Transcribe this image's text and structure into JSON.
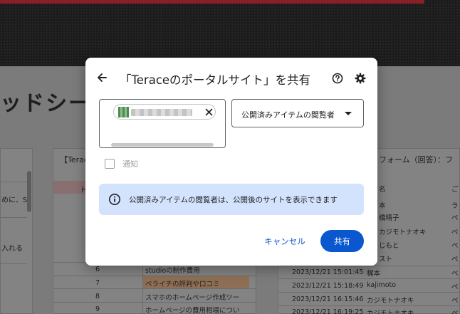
{
  "background": {
    "heading": "ッドシート",
    "left_panel_lines": [
      "めに、S",
      "入れる"
    ],
    "middle_panel": {
      "header": "【Terac",
      "tab_label": "ト",
      "rows": [
        {
          "num": "6",
          "text": "studioの制作費用"
        },
        {
          "num": "7",
          "text": "ペライチの評判や口コミ"
        },
        {
          "num": "8",
          "text": "スマホのホームページ作成ツー"
        },
        {
          "num": "9",
          "text": "ホームページの費用相場につい"
        }
      ]
    },
    "right_panel": {
      "header": "フォーム（回答）：フ",
      "col1": "名",
      "col2": "ご",
      "names": [
        "本",
        "橋晴子",
        "カジモトナオキ",
        "じもと",
        "スト"
      ],
      "side": [
        "ラ",
        "ペ",
        "ペ",
        "ペ",
        "ペ"
      ],
      "rows": [
        {
          "time": "2023/12/21 15:01:45",
          "name": "梶本",
          "side": "ペ"
        },
        {
          "time": "2023/12/21 15:18:49",
          "name": "kajimoto",
          "side": "ペ"
        },
        {
          "time": "2023/12/21 16:15:46",
          "name": "カジモトナオキ",
          "side": "ペ"
        },
        {
          "time": "2023/12/21 16:19:25",
          "name": "カジモトナオキ",
          "side": "ペ"
        }
      ]
    }
  },
  "dialog": {
    "title": "「Teraceのポータルサイト」を共有",
    "role_selected": "公開済みアイテムの閲覧者",
    "notify_label": "通知",
    "info_text": "公開済みアイテムの閲覧者は、公開後のサイトを表示できます",
    "cancel_label": "キャンセル",
    "share_label": "共有"
  },
  "icons": {
    "back": "arrow-left-icon",
    "help": "help-circle-icon",
    "settings": "gear-icon",
    "remove": "close-icon",
    "dropdown": "caret-down-icon",
    "info": "info-icon"
  },
  "colors": {
    "primary": "#0b57d0",
    "info_bg": "#d3e3fd",
    "text": "#202124",
    "muted": "#9aa0a6"
  }
}
